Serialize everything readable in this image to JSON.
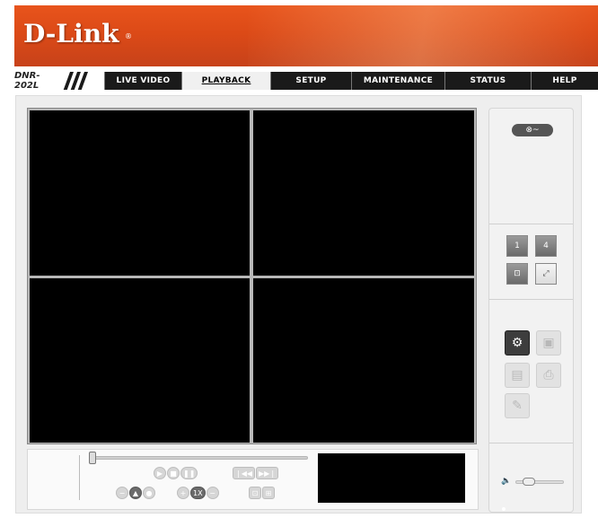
{
  "header": {
    "brand": "D-Link",
    "registered_mark": "®",
    "model": "DNR-202L"
  },
  "nav": {
    "tabs": [
      {
        "label": "LIVE VIDEO"
      },
      {
        "label": "PLAYBACK",
        "active": true
      },
      {
        "label": "SETUP"
      },
      {
        "label": "MAINTENANCE"
      },
      {
        "label": "STATUS"
      },
      {
        "label": "HELP"
      }
    ]
  },
  "colors": {
    "brand_orange": "#e8541c",
    "navbar": "#1a1a1a",
    "video_background": "#000000"
  },
  "video": {
    "layout": "quad",
    "panes": [
      1,
      2,
      3,
      4
    ]
  },
  "right_panel": {
    "search_button": {
      "icon": "film-reel-icon",
      "label": "⊗~"
    },
    "layout_buttons": [
      {
        "name": "layout-1-button",
        "label": "1"
      },
      {
        "name": "layout-4-button",
        "label": "4"
      },
      {
        "name": "digital-zoom-button",
        "icon": "zoom-frame-icon"
      },
      {
        "name": "fullscreen-button",
        "icon": "expand-icon"
      }
    ],
    "action_buttons": [
      {
        "name": "settings-button",
        "icon": "gears-icon",
        "enabled": true
      },
      {
        "name": "export-video-button",
        "icon": "save-video-icon",
        "enabled": false
      },
      {
        "name": "snapshot-button",
        "icon": "save-image-icon",
        "enabled": false
      },
      {
        "name": "print-button",
        "icon": "printer-icon",
        "enabled": false
      },
      {
        "name": "edit-button",
        "icon": "pencil-icon",
        "enabled": false
      }
    ],
    "volume": {
      "level": 0.2
    }
  },
  "playback": {
    "position": 0.0,
    "buttons": {
      "play": "▶",
      "stop": "■",
      "pause": "❚❚",
      "prev": "❘◀◀",
      "next": "▶▶❘",
      "speed_down": "−",
      "speed_up": "+",
      "speed_label": "1X",
      "mode_up": "▲",
      "zoom_in": "+",
      "zoom_out": "−"
    }
  }
}
